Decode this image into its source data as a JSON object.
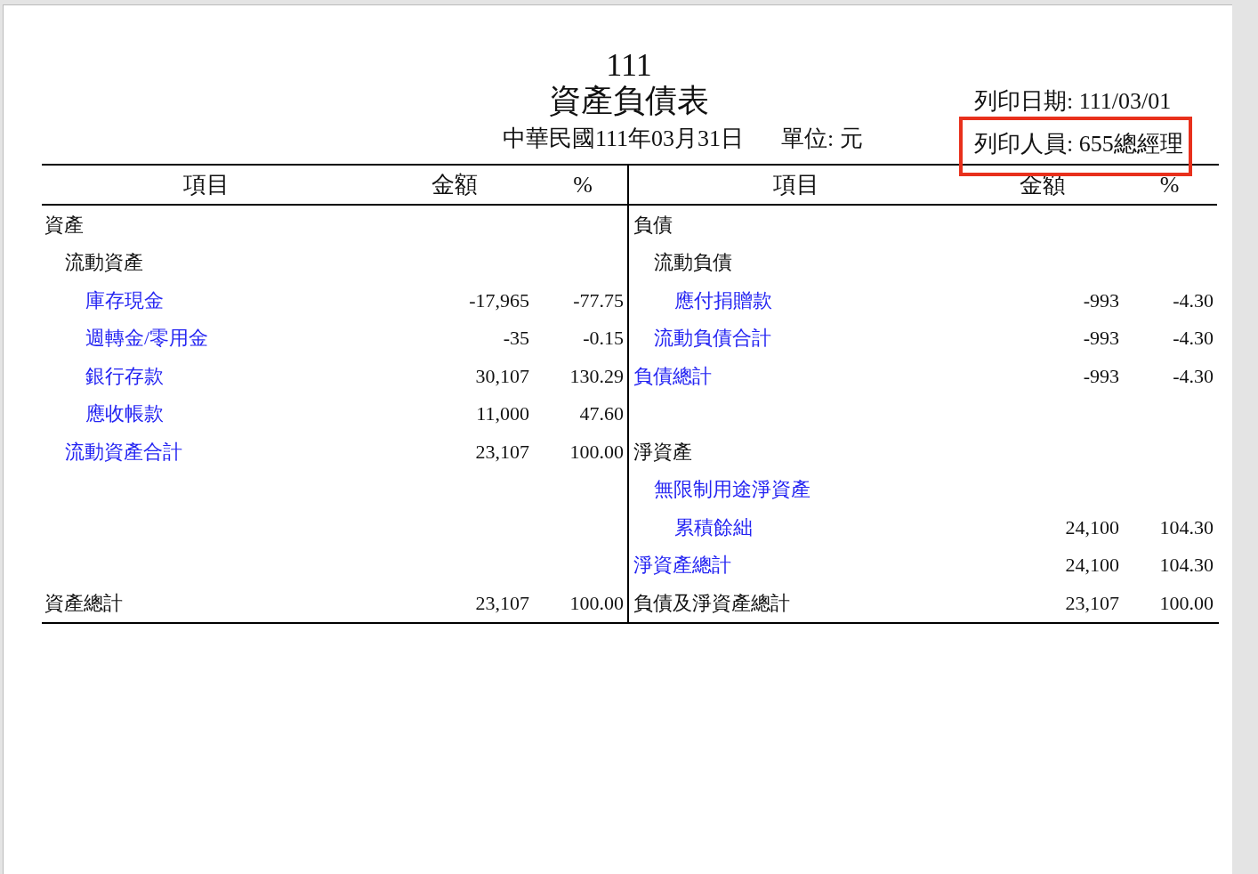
{
  "report": {
    "company": "111",
    "title": "資產負債表",
    "date_line": "中華民國111年03月31日",
    "unit": "單位: 元",
    "print_date": "列印日期: 111/03/01",
    "printed_by": "列印人員: 655總經理",
    "printed_by_highlighted": true
  },
  "left": {
    "header": [
      "項目",
      "金額",
      "%"
    ],
    "sections": [
      {
        "nodes": [
          {
            "label": "資產",
            "link": false,
            "children": [
              {
                "label": "流動資產",
                "link": false,
                "children": [
                  {
                    "label": "庫存現金",
                    "link": true,
                    "amount": "-17,965",
                    "percent": "-77.75"
                  },
                  {
                    "label": "週轉金/零用金",
                    "link": true,
                    "amount": "-35",
                    "percent": "-0.15"
                  },
                  {
                    "label": "銀行存款",
                    "link": true,
                    "amount": "30,107",
                    "percent": "130.29"
                  },
                  {
                    "label": "應收帳款",
                    "link": true,
                    "amount": "11,000",
                    "percent": "47.60"
                  }
                ]
              },
              {
                "label": "流動資產合計",
                "link": true,
                "amount": "23,107",
                "percent": "100.00"
              }
            ]
          }
        ]
      }
    ],
    "total": {
      "label": "資產總計",
      "link": false,
      "amount": "23,107",
      "percent": "100.00"
    }
  },
  "right": {
    "header": [
      "項目",
      "金額",
      "%"
    ],
    "sections": [
      {
        "nodes": [
          {
            "label": "負債",
            "link": false,
            "children": [
              {
                "label": "流動負債",
                "link": false,
                "children": [
                  {
                    "label": "應付捐贈款",
                    "link": true,
                    "amount": "-993",
                    "percent": "-4.30"
                  }
                ]
              },
              {
                "label": "流動負債合計",
                "link": true,
                "amount": "-993",
                "percent": "-4.30"
              }
            ]
          },
          {
            "label": "負債總計",
            "link": true,
            "amount": "-993",
            "percent": "-4.30"
          }
        ]
      },
      {
        "nodes": [
          {
            "label": "淨資產",
            "link": false,
            "children": [
              {
                "label": "無限制用途淨資產",
                "link": true,
                "children": [
                  {
                    "label": "累積餘絀",
                    "link": true,
                    "amount": "24,100",
                    "percent": "104.30"
                  }
                ]
              }
            ]
          },
          {
            "label": "淨資產總計",
            "link": true,
            "amount": "24,100",
            "percent": "104.30"
          }
        ]
      }
    ],
    "total": {
      "label": "負債及淨資產總計",
      "link": false,
      "amount": "23,107",
      "percent": "100.00"
    }
  }
}
